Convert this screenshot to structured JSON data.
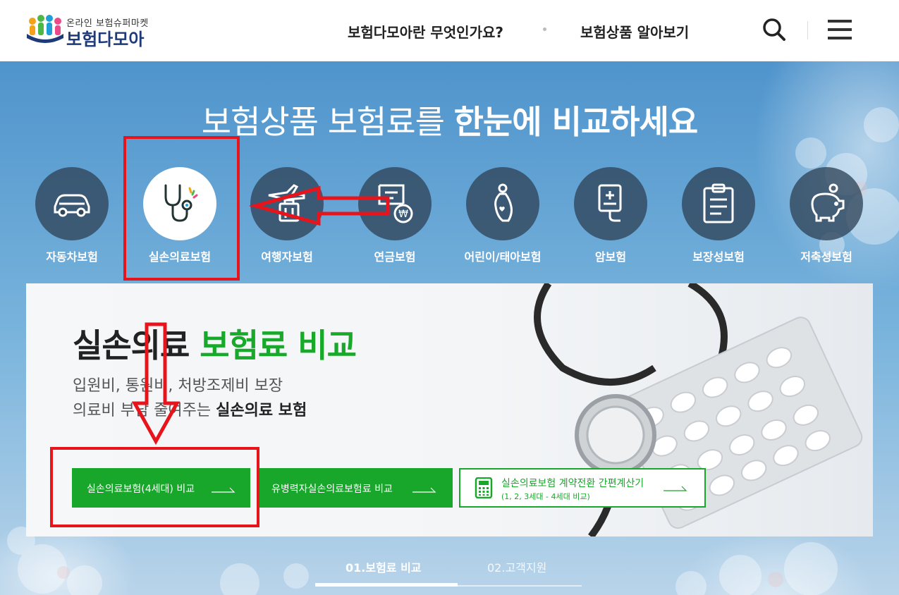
{
  "header": {
    "logo_sub": "온라인 보험슈퍼마켓",
    "logo_main": "보험다모아",
    "nav": [
      "보험다모아란 무엇인가요?",
      "보험상품 알아보기"
    ]
  },
  "hero": {
    "headline_normal": "보험상품 보험료를 ",
    "headline_bold": "한눈에 비교하세요"
  },
  "categories": [
    {
      "label": "자동차보험",
      "icon": "car-icon"
    },
    {
      "label": "실손의료보험",
      "icon": "stethoscope-icon"
    },
    {
      "label": "여행자보험",
      "icon": "airplane-luggage-icon"
    },
    {
      "label": "연금보험",
      "icon": "pension-document-icon"
    },
    {
      "label": "어린이/태아보험",
      "icon": "pregnant-icon"
    },
    {
      "label": "암보험",
      "icon": "iv-bag-icon"
    },
    {
      "label": "보장성보험",
      "icon": "clipboard-icon"
    },
    {
      "label": "저축성보험",
      "icon": "piggy-bank-icon"
    }
  ],
  "panel": {
    "title_dark": "실손의료 ",
    "title_green": "보험료 비교",
    "desc_line1": "입원비, 통원비, 처방조제비 보장",
    "desc_line2_normal": "의료비 부담 줄여주는 ",
    "desc_line2_bold": "실손의료 보험",
    "buttons": [
      {
        "label": "실손의료보험(4세대) 비교"
      },
      {
        "label": "유병력자실손의료보험료 비교"
      },
      {
        "label": "실손의료보험 계약전환 간편계산기",
        "sub": "(1, 2, 3세대 - 4세대 비교)"
      }
    ]
  },
  "tabs": [
    "01.보험료 비교",
    "02.고객지원"
  ],
  "colors": {
    "accent_green": "#19a72b",
    "annotation_red": "#e8141c",
    "logo_navy": "#1e3a78"
  }
}
